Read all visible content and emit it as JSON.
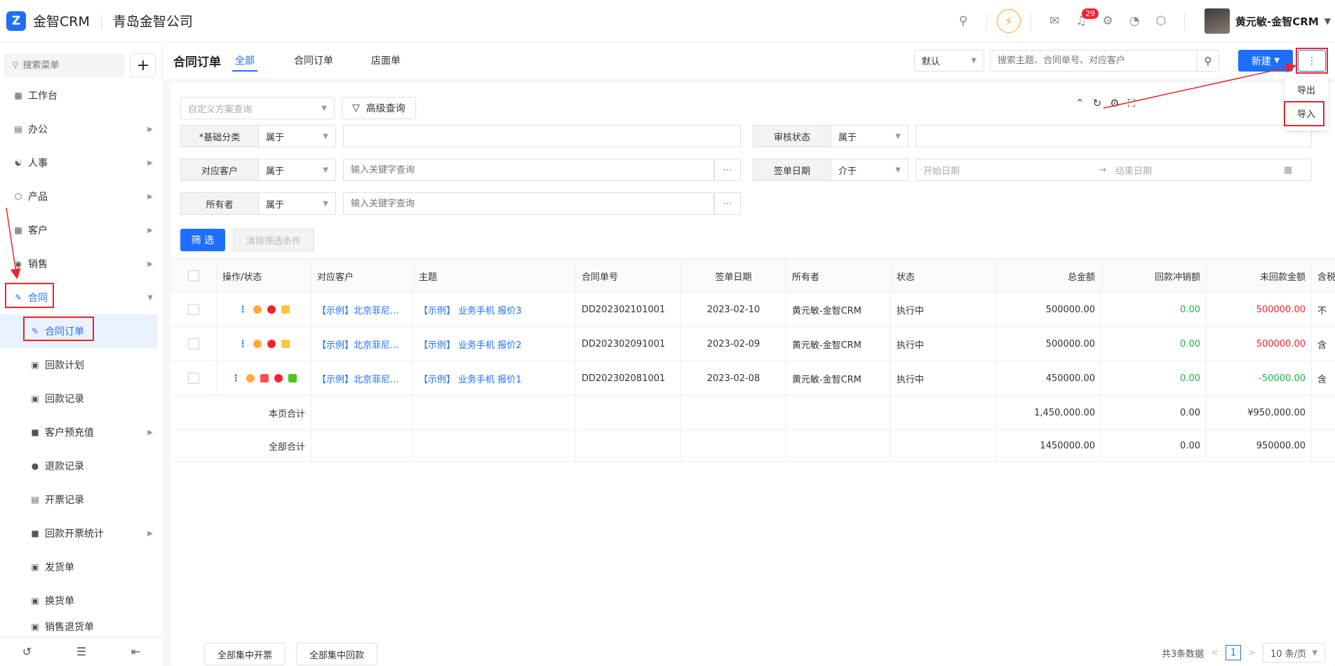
{
  "header": {
    "logo_text": "金智CRM",
    "company": "青岛金智公司",
    "notification_count": "29",
    "user_name": "黄元敏-金智CRM"
  },
  "sidebar": {
    "search_placeholder": "搜索菜单",
    "items": [
      {
        "label": "工作台",
        "icon": "dashboard-icon"
      },
      {
        "label": "办公",
        "icon": "office-icon"
      },
      {
        "label": "人事",
        "icon": "hr-icon"
      },
      {
        "label": "产品",
        "icon": "product-icon"
      },
      {
        "label": "客户",
        "icon": "customer-icon"
      },
      {
        "label": "销售",
        "icon": "sales-icon"
      },
      {
        "label": "合同",
        "icon": "contract-icon"
      }
    ],
    "sub_items": [
      {
        "label": "合同订单"
      },
      {
        "label": "回款计划"
      },
      {
        "label": "回款记录"
      },
      {
        "label": "客户预充值"
      },
      {
        "label": "退款记录"
      },
      {
        "label": "开票记录"
      },
      {
        "label": "回款开票统计"
      },
      {
        "label": "发货单"
      },
      {
        "label": "换货单"
      },
      {
        "label": "销售退货单"
      }
    ]
  },
  "main": {
    "title": "合同订单",
    "tabs": [
      {
        "label": "全部"
      },
      {
        "label": "合同订单"
      },
      {
        "label": "店面单"
      }
    ],
    "view_select": "默认",
    "search_placeholder": "搜索主题、合同单号、对应客户",
    "new_button": "新建",
    "more_menu": [
      {
        "label": "导出"
      },
      {
        "label": "导入"
      }
    ]
  },
  "filters": {
    "scheme_placeholder": "自定义方案查询",
    "advanced_label": "高级查询",
    "rows": [
      {
        "label": "*基础分类",
        "op": "属于",
        "placeholder": ""
      },
      {
        "label": "审核状态",
        "op": "属于",
        "placeholder": ""
      },
      {
        "label": "对应客户",
        "op": "属于",
        "placeholder": "输入关键字查询"
      },
      {
        "label": "签单日期",
        "op": "介于",
        "start_placeholder": "开始日期",
        "end_placeholder": "结束日期"
      },
      {
        "label": "所有者",
        "op": "属于",
        "placeholder": "输入关键字查询"
      }
    ],
    "filter_button": "筛 选",
    "clear_button": "清除筛选条件"
  },
  "table": {
    "columns": [
      "操作/状态",
      "对应客户",
      "主题",
      "合同单号",
      "签单日期",
      "所有者",
      "状态",
      "总金额",
      "回款冲销额",
      "未回款金额",
      "含税"
    ],
    "rows": [
      {
        "customer": "【示例】北京菲尼...",
        "subject": "【示例】 业务手机 报价3",
        "no": "DD202302101001",
        "date": "2023-02-10",
        "owner": "黄元敏-金智CRM",
        "status": "执行中",
        "total": "500000.00",
        "paid": "0.00",
        "unpaid": "500000.00",
        "tax": "不"
      },
      {
        "customer": "【示例】北京菲尼...",
        "subject": "【示例】 业务手机 报价2",
        "no": "DD202302091001",
        "date": "2023-02-09",
        "owner": "黄元敏-金智CRM",
        "status": "执行中",
        "total": "500000.00",
        "paid": "0.00",
        "unpaid": "500000.00",
        "tax": "含"
      },
      {
        "customer": "【示例】北京菲尼...",
        "subject": "【示例】 业务手机 报价1",
        "no": "DD202302081001",
        "date": "2023-02-08",
        "owner": "黄元敏-金智CRM",
        "status": "执行中",
        "total": "450000.00",
        "paid": "0.00",
        "unpaid": "-50000.00",
        "tax": "含"
      }
    ],
    "page_total": {
      "label": "本页合计",
      "total": "1,450,000.00",
      "paid": "0.00",
      "unpaid": "¥950,000.00"
    },
    "all_total": {
      "label": "全部合计",
      "total": "1450000.00",
      "paid": "0.00",
      "unpaid": "950000.00"
    }
  },
  "footer": {
    "batch_invoice": "全部集中开票",
    "batch_payment": "全部集中回款",
    "count_text": "共3条数据",
    "current_page": "1",
    "page_size": "10 条/页"
  },
  "colors": {
    "accent": "#1e6fff",
    "highlight": "#e8262b",
    "positive": "#19b34a",
    "negative": "#f5222d"
  }
}
